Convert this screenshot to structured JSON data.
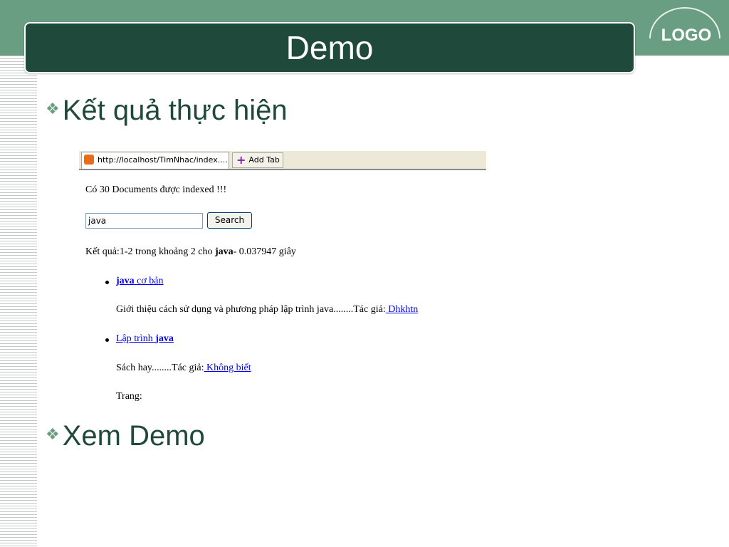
{
  "slide": {
    "title": "Demo",
    "logo": "LOGO",
    "bullets": [
      "Kết quả thực hiện",
      "Xem Demo"
    ],
    "bullet_icon": "diamond-bullet-icon"
  },
  "browser": {
    "tab_title": "http://localhost/TimNhac/index....",
    "add_tab": "Add Tab",
    "doc_count_text": "Có 30 Documents được indexed !!!",
    "search_value": "java",
    "search_button": "Search",
    "result_prefix": "Kết quả:1-2 trong khoảng 2 cho ",
    "result_query": "java",
    "result_suffix": "- 0.037947 giây",
    "results": [
      {
        "link_bold": "java",
        "link_rest": " cơ bản",
        "desc": "Giới thiệu cách sử dụng và phương pháp lập trình java........Tác giả:",
        "author": " Dhkhtn"
      },
      {
        "link_rest": "Lập trình ",
        "link_bold": "java",
        "desc": "Sách hay........Tác giả:",
        "author": " Không biết"
      }
    ],
    "paging_label": "Trang:"
  },
  "colors": {
    "title_bar": "#1f4a3b",
    "band": "#6a9e82",
    "link": "#0000ee"
  }
}
